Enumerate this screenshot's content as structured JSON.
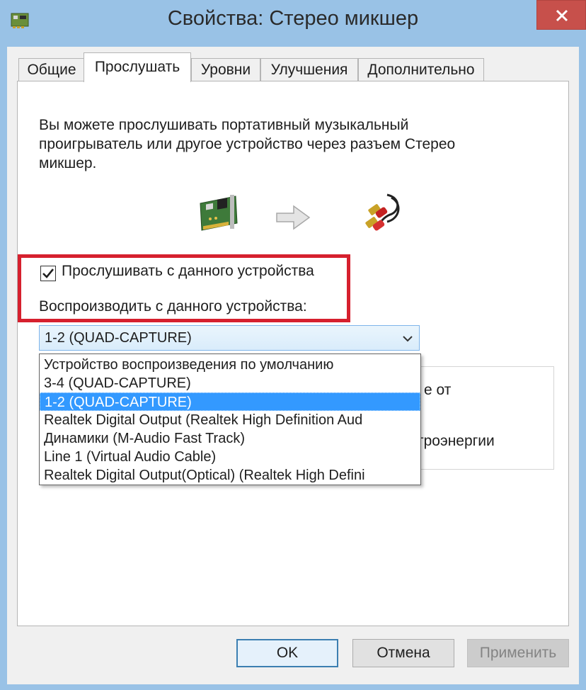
{
  "window": {
    "title": "Свойства: Стерео микшер",
    "icon": "sound-device-icon",
    "close_icon": "close-icon"
  },
  "tabs": [
    {
      "label": "Общие"
    },
    {
      "label": "Прослушать",
      "active": true
    },
    {
      "label": "Уровни"
    },
    {
      "label": "Улучшения"
    },
    {
      "label": "Дополнительно"
    }
  ],
  "listen": {
    "description": "Вы можете прослушивать портативный музыкальный\nпроигрыватель или другое устройство через разъем Стерео\nмикшер.",
    "images": [
      "sound-card-icon",
      "arrow-right-icon",
      "audio-cable-icon"
    ],
    "listen_checkbox": {
      "label": "Прослушивать с данного устройства",
      "checked": true
    },
    "playback_label": "Воспроизводить с данного устройства:",
    "playback_select": {
      "value": "1-2 (QUAD-CAPTURE)",
      "options": [
        "Устройство воспроизведения по умолчанию",
        "3-4 (QUAD-CAPTURE)",
        "1-2 (QUAD-CAPTURE)",
        "Realtek Digital Output (Realtek High Definition Aud",
        "Динамики (M-Audio Fast Track)",
        "Line 1 (Virtual Audio Cable)",
        "Realtek Digital Output(Optical) (Realtek High Defini"
      ],
      "selected_index": 2
    },
    "power_group": {
      "text_fragment_1": "е от",
      "text_fragment_2": "троэнергии"
    }
  },
  "buttons": {
    "ok": "OK",
    "cancel": "Отмена",
    "apply": "Применить"
  },
  "colors": {
    "highlight": "#d6202e",
    "selection": "#3399ff",
    "titlebar": "#99c2e6"
  }
}
